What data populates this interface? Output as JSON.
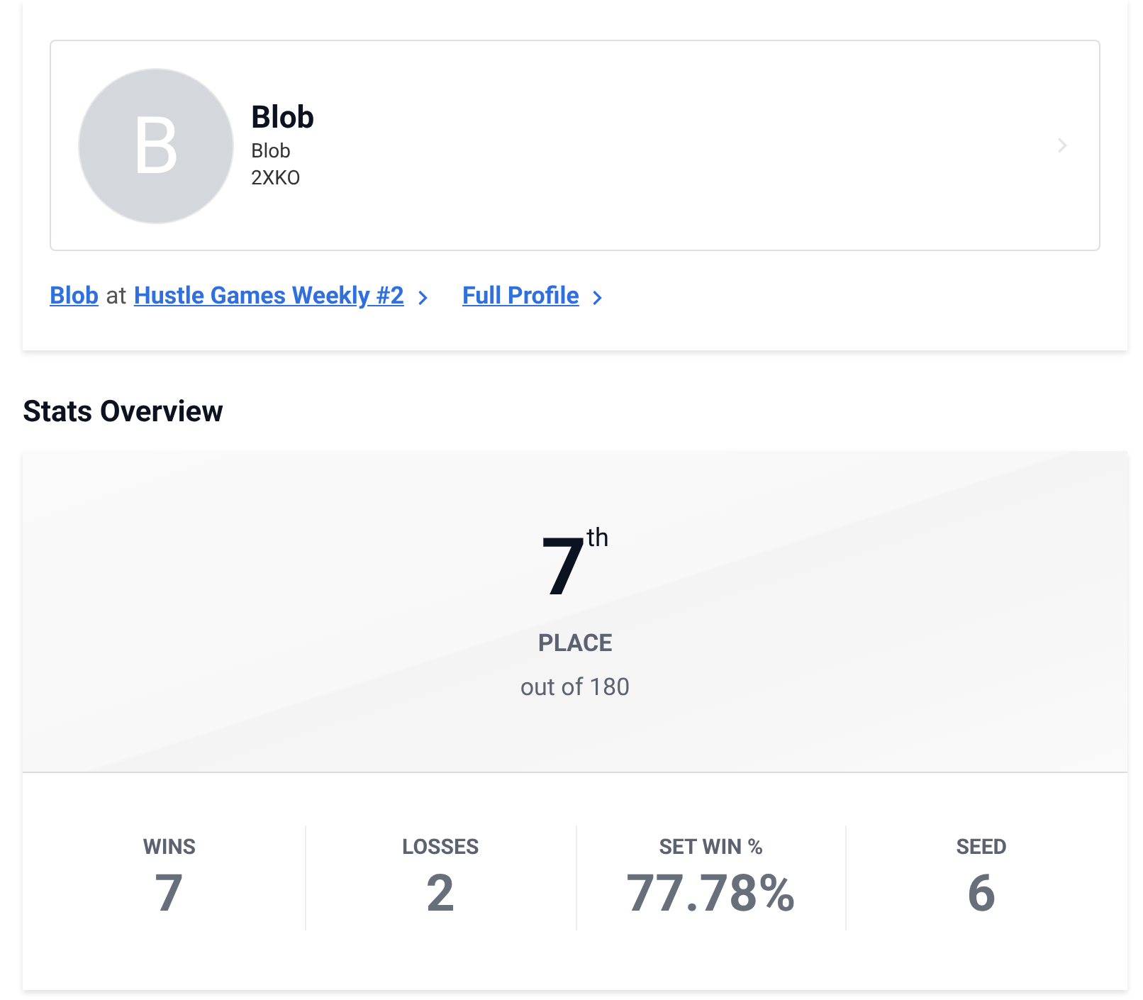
{
  "profile": {
    "initial": "B",
    "name": "Blob",
    "subtitle": "Blob",
    "game": "2XKO"
  },
  "links": {
    "player": "Blob",
    "connector": "at",
    "event": "Hustle Games Weekly #2",
    "full_profile": "Full Profile"
  },
  "stats_heading": "Stats Overview",
  "placement": {
    "rank": "7",
    "suffix": "th",
    "label": "PLACE",
    "total": "out of 180"
  },
  "stats": [
    {
      "label": "WINS",
      "value": "7"
    },
    {
      "label": "LOSSES",
      "value": "2"
    },
    {
      "label": "SET WIN %",
      "value": "77.78%"
    },
    {
      "label": "SEED",
      "value": "6"
    }
  ]
}
